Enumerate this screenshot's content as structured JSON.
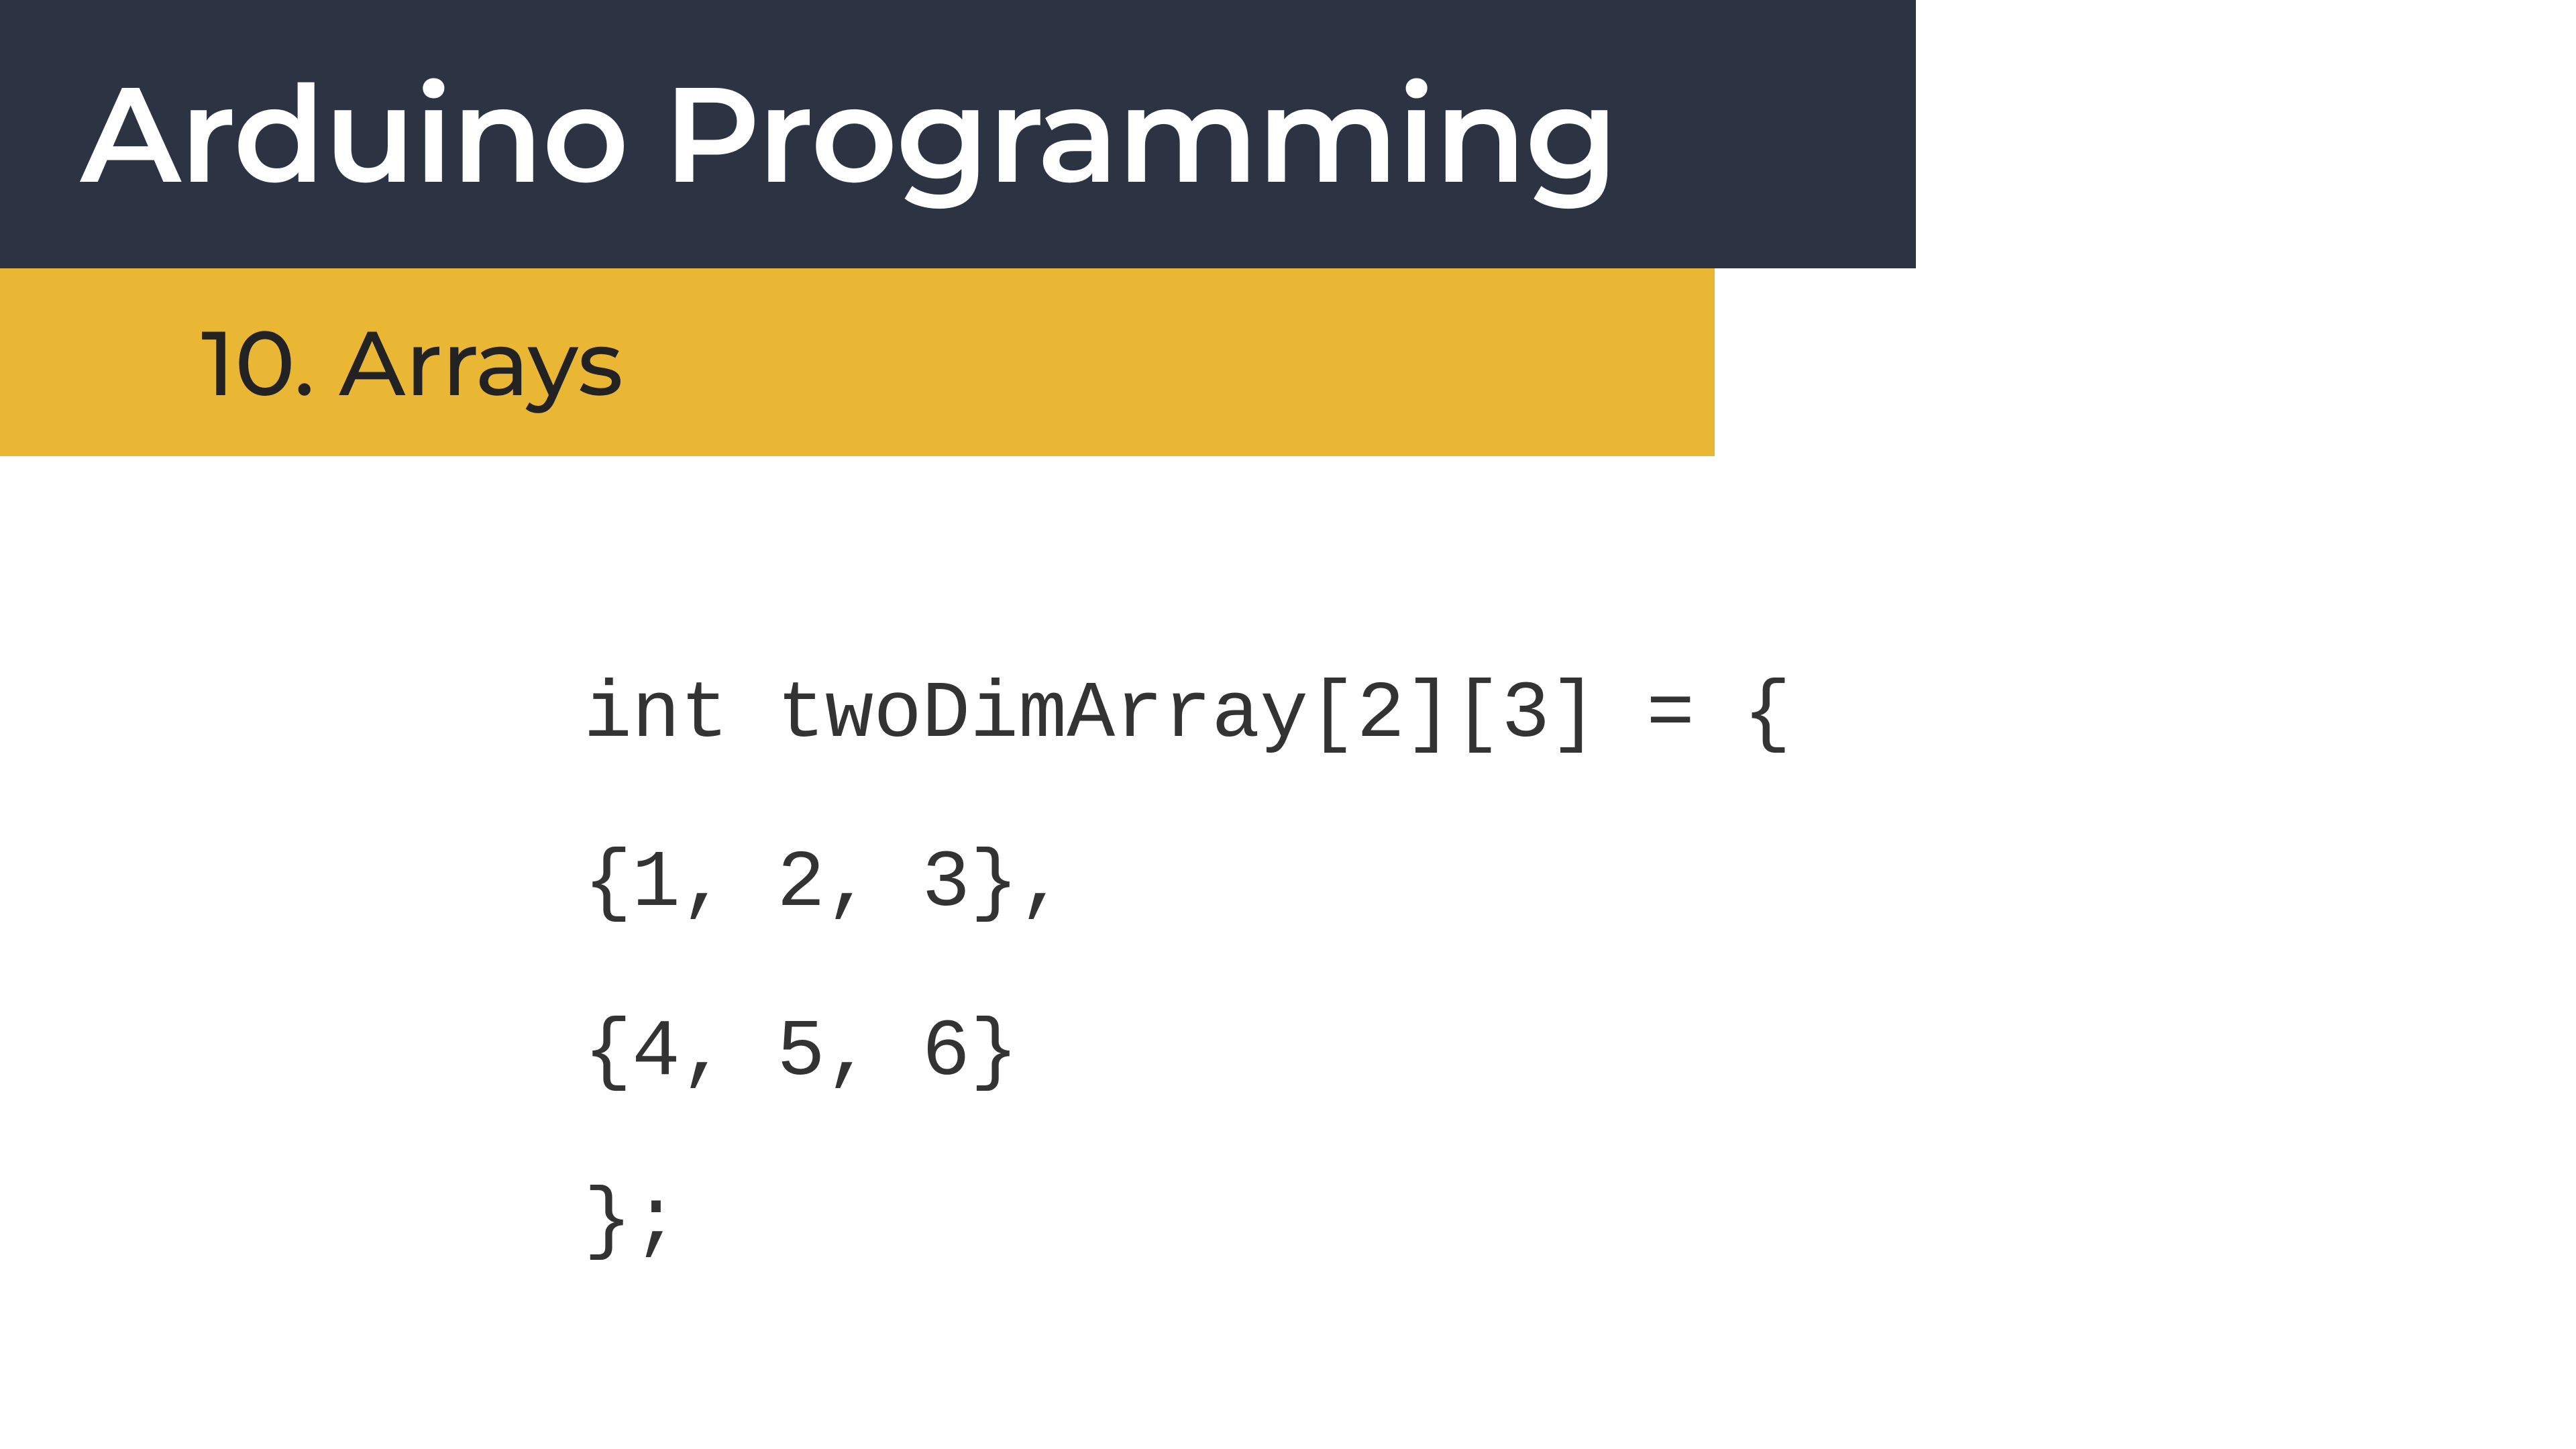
{
  "header": {
    "title": "Arduino Programming"
  },
  "subheader": {
    "title": "10. Arrays"
  },
  "code": {
    "line1": "int twoDimArray[2][3] = {",
    "line2": "{1, 2, 3},",
    "line3": "{4, 5, 6}",
    "line4": "};"
  },
  "colors": {
    "header_bg": "#2c3443",
    "subheader_bg": "#eab735",
    "text_light": "#ffffff",
    "text_dark": "#222222"
  }
}
